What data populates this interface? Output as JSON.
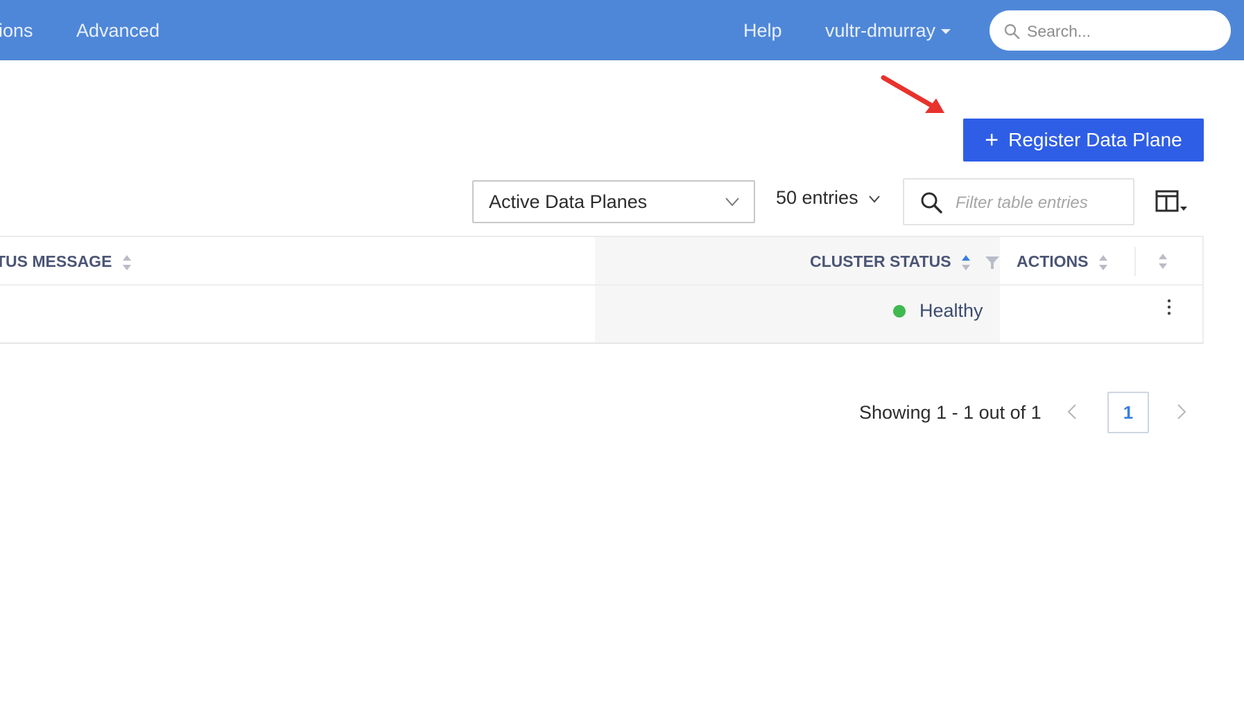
{
  "topbar": {
    "nav_items": [
      {
        "label": "ions"
      },
      {
        "label": "Advanced"
      },
      {
        "label": "Help"
      },
      {
        "label": "vultr-dmurray"
      }
    ],
    "search_placeholder": "Search...",
    "background_color": "#4f87d8"
  },
  "toolbar": {
    "register_button_label": "Register Data Plane",
    "planes_filter_value": "Active Data Planes",
    "entries_value": "50 entries",
    "filter_placeholder": "Filter table entries"
  },
  "table": {
    "columns": [
      {
        "label": "TUS MESSAGE"
      },
      {
        "label": "CLUSTER STATUS"
      },
      {
        "label": "ACTIONS"
      }
    ],
    "rows": [
      {
        "cluster_status": "Healthy",
        "status_color": "#3fb950"
      }
    ]
  },
  "pagination": {
    "info": "Showing 1 - 1 out of 1",
    "current_page": "1"
  },
  "annotation": {
    "arrow_color": "#e8322c"
  }
}
